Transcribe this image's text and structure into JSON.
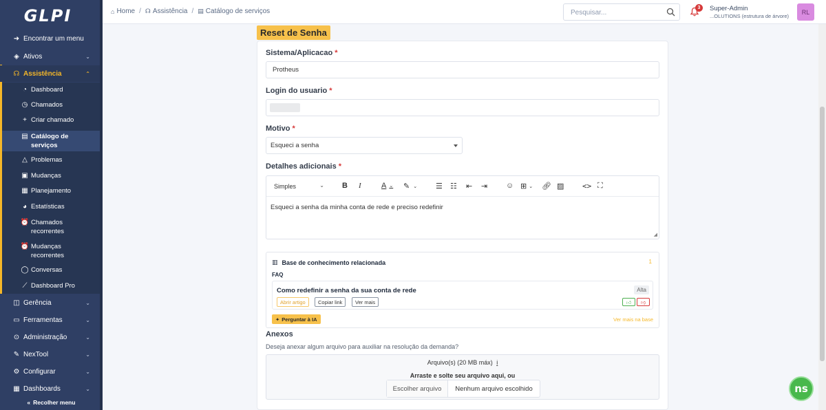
{
  "app": {
    "logo": "GLPI"
  },
  "sidebar": {
    "items": [
      {
        "label": "Encontrar um menu"
      },
      {
        "label": "Ativos"
      },
      {
        "label": "Assistência"
      },
      {
        "label": "Gerência"
      },
      {
        "label": "Ferramentas"
      },
      {
        "label": "Administração"
      },
      {
        "label": "NexTool"
      },
      {
        "label": "Configurar"
      },
      {
        "label": "Dashboards"
      }
    ],
    "subitems": [
      {
        "label": "Dashboard"
      },
      {
        "label": "Chamados"
      },
      {
        "label": "Criar chamado"
      },
      {
        "label": "Catálogo de serviços"
      },
      {
        "label": "Problemas"
      },
      {
        "label": "Mudanças"
      },
      {
        "label": "Planejamento"
      },
      {
        "label": "Estatísticas"
      },
      {
        "label": "Chamados recorrentes"
      },
      {
        "label": "Mudanças recorrentes"
      },
      {
        "label": "Conversas"
      },
      {
        "label": "Dashboard Pro"
      }
    ],
    "collapse_label": "Recolher menu",
    "active_color": "#f5b728"
  },
  "header": {
    "breadcrumb": [
      "Home",
      "Assistência",
      "Catálogo de serviços"
    ],
    "search_placeholder": "Pesquisar...",
    "notifications_count": "3",
    "user_name": "Super-Admin",
    "user_entity": "...OLUTIONS (estrutura de árvore)",
    "avatar_initials": "RL"
  },
  "form": {
    "tab_title": "Reset de Senha",
    "fields": {
      "sistema": {
        "label": "Sistema/Aplicacao",
        "value": "Protheus"
      },
      "login": {
        "label": "Login do usuario",
        "value": ""
      },
      "motivo": {
        "label": "Motivo",
        "value": "Esqueci a senha"
      },
      "detalhes": {
        "label": "Detalhes adicionais",
        "format": "Simples",
        "value": "Esqueci a senha da minha conta de rede e preciso redefinir"
      }
    },
    "required_mark": "*"
  },
  "kb": {
    "title": "Base de conhecimento relacionada",
    "count": "1",
    "section": "FAQ",
    "item_title": "Como redefinir a senha da sua conta de rede",
    "priority": "Alta",
    "open_label": "Abrir artigo",
    "copy_label": "Copiar link",
    "view_label": "Ver mais",
    "ask_label": "Perguntar à IA",
    "more_label": "Ver mais na base"
  },
  "anexos": {
    "title": "Anexos",
    "description": "Deseja anexar algum arquivo para auxiliar na resolução da demanda?",
    "limit": "Arquivo(s) (20 MB máx)",
    "info_mark": "i",
    "drop_text": "Arraste e solte seu arquivo aqui, ou",
    "choose_label": "Escolher arquivo",
    "no_file_label": "Nenhum arquivo escolhido"
  },
  "fab": {
    "label": "ns"
  }
}
